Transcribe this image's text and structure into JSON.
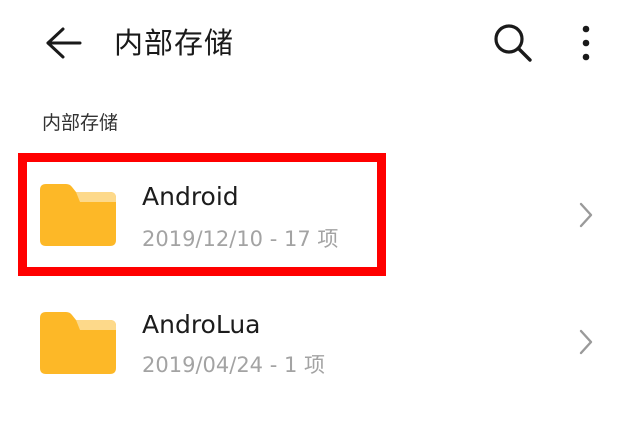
{
  "app_bar": {
    "back_icon": "back-arrow-icon",
    "title": "内部存储",
    "search_icon": "search-icon",
    "more_icon": "more-vertical-icon"
  },
  "section": {
    "header": "内部存储"
  },
  "items": [
    {
      "name": "Android",
      "meta": "2019/12/10 - 17 项",
      "icon": "folder-icon",
      "highlighted": true
    },
    {
      "name": "AndroLua",
      "meta": "2019/04/24 - 1 项",
      "icon": "folder-icon",
      "highlighted": false
    }
  ],
  "colors": {
    "folder_body": "#FDB827",
    "folder_tab": "#FDD98A",
    "highlight": "#FF0000",
    "meta_text": "#A3A3A3"
  }
}
